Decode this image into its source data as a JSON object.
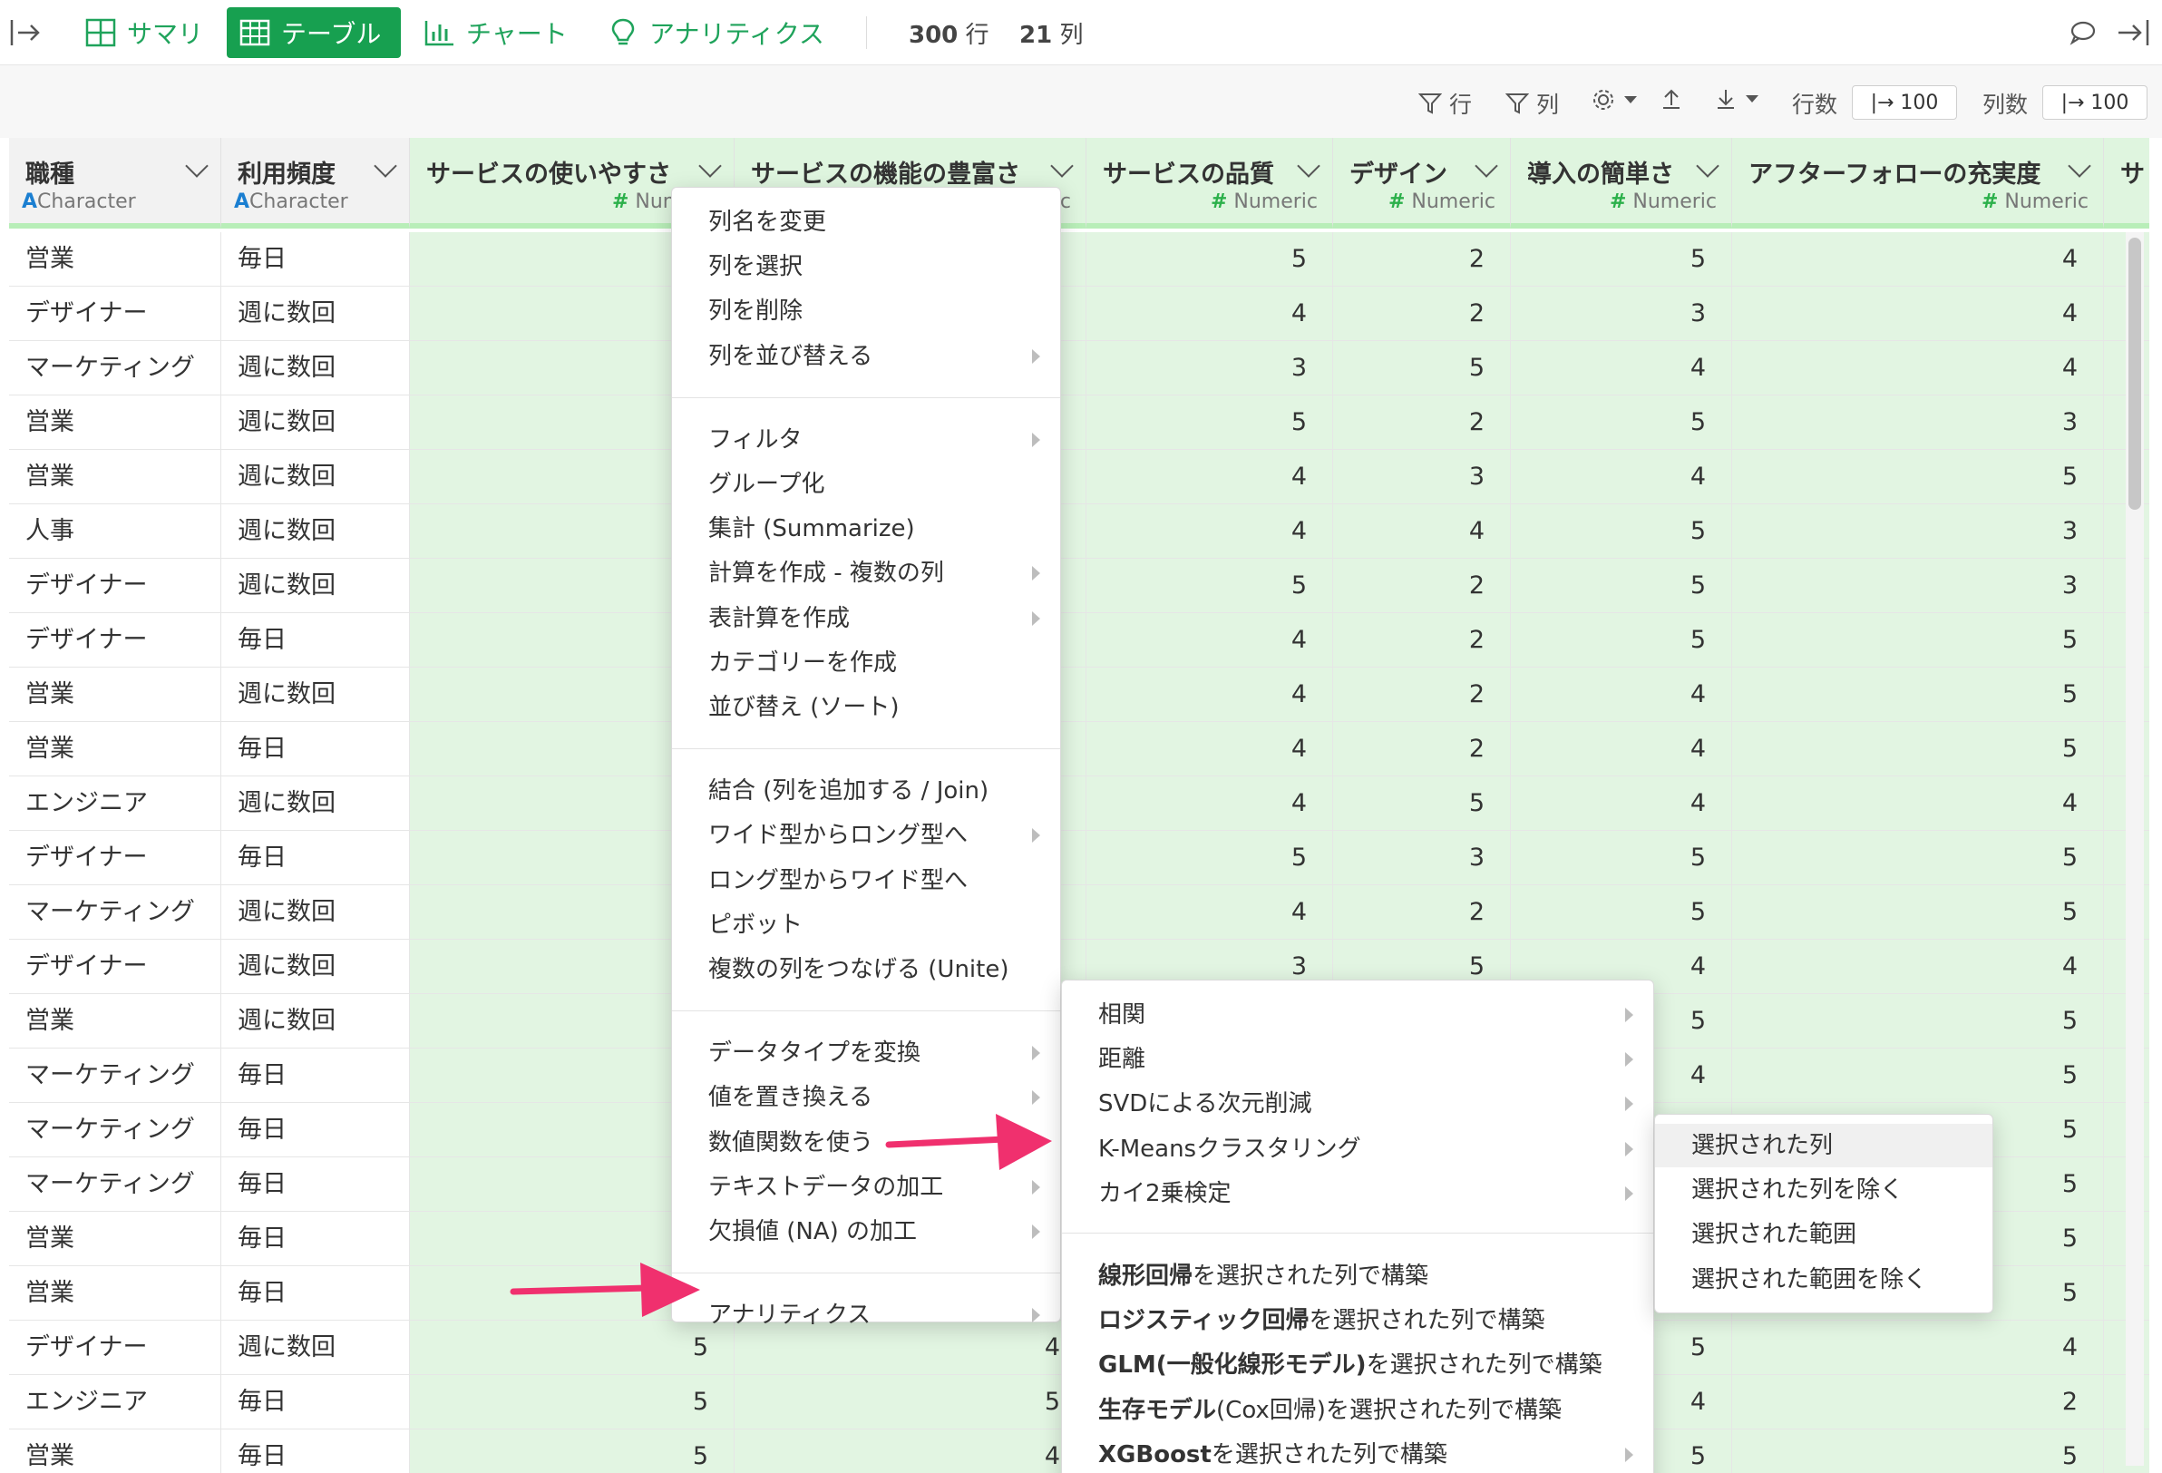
{
  "toolbar": {
    "summary_label": "サマリ",
    "table_label": "テーブル",
    "chart_label": "チャート",
    "analytics_label": "アナリティクス",
    "rows_count": "300",
    "rows_unit": "行",
    "cols_count": "21",
    "cols_unit": "列"
  },
  "subbar": {
    "row_filter": "行",
    "col_filter": "列",
    "rows_label": "行数",
    "rows_value": "|→ 100",
    "cols_label": "列数",
    "cols_value": "|→ 100"
  },
  "columns": [
    {
      "name": "職種",
      "type_prefix": "A",
      "type": "Character"
    },
    {
      "name": "利用頻度",
      "type_prefix": "A",
      "type": "Character"
    },
    {
      "name": "サービスの使いやすさ",
      "type_prefix": "#",
      "type": "Numeric"
    },
    {
      "name": "サービスの機能の豊富さ",
      "type_prefix": "#",
      "type": "Numeric"
    },
    {
      "name": "サービスの品質",
      "type_prefix": "#",
      "type": "Numeric"
    },
    {
      "name": "デザイン",
      "type_prefix": "#",
      "type": "Numeric"
    },
    {
      "name": "導入の簡単さ",
      "type_prefix": "#",
      "type": "Numeric"
    },
    {
      "name": "アフターフォローの充実度",
      "type_prefix": "#",
      "type": "Numeric"
    },
    {
      "name": "サ",
      "type_prefix": "",
      "type": ""
    }
  ],
  "rows": [
    [
      "営業",
      "毎日",
      "",
      "5",
      "5",
      "2",
      "5",
      "4"
    ],
    [
      "デザイナー",
      "週に数回",
      "",
      "4",
      "4",
      "2",
      "3",
      "4"
    ],
    [
      "マーケティング",
      "週に数回",
      "",
      "4",
      "3",
      "5",
      "4",
      "4"
    ],
    [
      "営業",
      "週に数回",
      "",
      "5",
      "5",
      "2",
      "5",
      "3"
    ],
    [
      "営業",
      "週に数回",
      "",
      "5",
      "4",
      "3",
      "4",
      "5"
    ],
    [
      "人事",
      "週に数回",
      "",
      "4",
      "4",
      "4",
      "5",
      "3"
    ],
    [
      "デザイナー",
      "週に数回",
      "",
      "5",
      "5",
      "2",
      "5",
      "3"
    ],
    [
      "デザイナー",
      "毎日",
      "",
      "4",
      "4",
      "2",
      "5",
      "5"
    ],
    [
      "営業",
      "週に数回",
      "",
      "4",
      "4",
      "2",
      "4",
      "5"
    ],
    [
      "営業",
      "毎日",
      "",
      "4",
      "4",
      "2",
      "4",
      "5"
    ],
    [
      "エンジニア",
      "週に数回",
      "",
      "4",
      "4",
      "5",
      "4",
      "4"
    ],
    [
      "デザイナー",
      "毎日",
      "",
      "4",
      "5",
      "3",
      "5",
      "5"
    ],
    [
      "マーケティング",
      "週に数回",
      "",
      "4",
      "4",
      "2",
      "5",
      "5"
    ],
    [
      "デザイナー",
      "週に数回",
      "",
      "4",
      "3",
      "5",
      "4",
      "4"
    ],
    [
      "営業",
      "週に数回",
      "",
      "",
      "",
      "",
      "5",
      "5"
    ],
    [
      "マーケティング",
      "毎日",
      "",
      "",
      "",
      "",
      "4",
      "5"
    ],
    [
      "マーケティング",
      "毎日",
      "",
      "",
      "",
      "",
      "",
      "5"
    ],
    [
      "マーケティング",
      "毎日",
      "",
      "",
      "",
      "",
      "",
      "5"
    ],
    [
      "営業",
      "毎日",
      "",
      "",
      "",
      "",
      "",
      "5"
    ],
    [
      "営業",
      "毎日",
      "",
      "",
      "",
      "",
      "",
      "5"
    ],
    [
      "デザイナー",
      "週に数回",
      "5",
      "4",
      "",
      "",
      "5",
      "4"
    ],
    [
      "エンジニア",
      "毎日",
      "5",
      "5",
      "",
      "",
      "4",
      "2"
    ],
    [
      "営業",
      "毎日",
      "5",
      "4",
      "",
      "",
      "5",
      "5"
    ]
  ],
  "context_menu": {
    "groups": [
      [
        {
          "label": "列名を変更",
          "sub": false
        },
        {
          "label": "列を選択",
          "sub": false
        },
        {
          "label": "列を削除",
          "sub": false
        },
        {
          "label": "列を並び替える",
          "sub": true
        }
      ],
      [
        {
          "label": "フィルタ",
          "sub": true
        },
        {
          "label": "グループ化",
          "sub": false
        },
        {
          "label": "集計 (Summarize)",
          "sub": false
        },
        {
          "label": "計算を作成 - 複数の列",
          "sub": true
        },
        {
          "label": "表計算を作成",
          "sub": true
        },
        {
          "label": "カテゴリーを作成",
          "sub": false
        },
        {
          "label": "並び替え (ソート)",
          "sub": false
        }
      ],
      [
        {
          "label": "結合 (列を追加する / Join)",
          "sub": false
        },
        {
          "label": "ワイド型からロング型へ",
          "sub": true
        },
        {
          "label": "ロング型からワイド型へ",
          "sub": false
        },
        {
          "label": "ピボット",
          "sub": false
        },
        {
          "label": "複数の列をつなげる (Unite)",
          "sub": false
        }
      ],
      [
        {
          "label": "データタイプを変換",
          "sub": true
        },
        {
          "label": "値を置き換える",
          "sub": true
        },
        {
          "label": "数値関数を使う",
          "sub": true
        },
        {
          "label": "テキストデータの加工",
          "sub": true
        },
        {
          "label": "欠損値 (NA) の加工",
          "sub": true
        }
      ],
      [
        {
          "label": "アナリティクス",
          "sub": true
        }
      ]
    ]
  },
  "analytics_menu": {
    "items": [
      {
        "label": "相関",
        "sub": true
      },
      {
        "label": "距離",
        "sub": true
      },
      {
        "label": "SVDによる次元削減",
        "sub": true
      },
      {
        "label": "K-Meansクラスタリング",
        "sub": true
      },
      {
        "label": "カイ2乗検定",
        "sub": true
      }
    ],
    "model_items": [
      {
        "bold": "線形回帰",
        "rest": "を選択された列で構築",
        "sub": false
      },
      {
        "bold": "ロジスティック回帰",
        "rest": "を選択された列で構築",
        "sub": false
      },
      {
        "bold": "GLM(一般化線形モデル)",
        "rest": "を選択された列で構築",
        "sub": false
      },
      {
        "bold": "生存モデル",
        "rest": "(Cox回帰)を選択された列で構築",
        "sub": false
      },
      {
        "bold": "XGBoost",
        "rest": "を選択された列で構築",
        "sub": true
      }
    ]
  },
  "kmeans_menu": {
    "items": [
      "選択された列",
      "選択された列を除く",
      "選択された範囲",
      "選択された範囲を除く"
    ]
  },
  "colors": {
    "brand_green": "#17a050",
    "numeric_bg": "#e2f5e2",
    "annotation_arrow": "#f0306e"
  }
}
